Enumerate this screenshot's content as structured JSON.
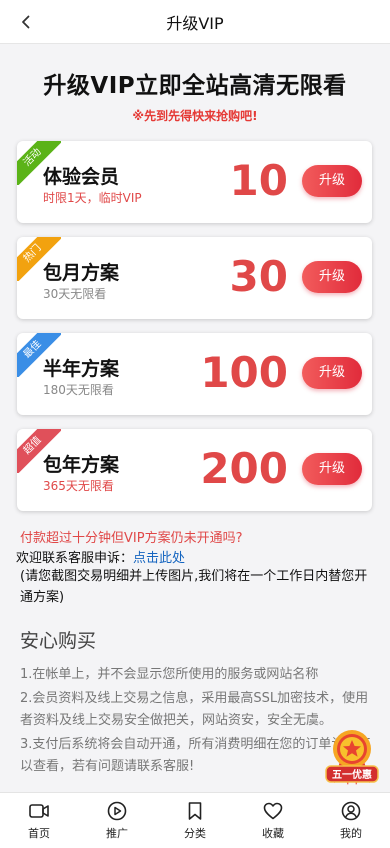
{
  "header": {
    "title": "升级VIP"
  },
  "hero": {
    "headline": "升级VIP立即全站高清无限看",
    "subline": "※先到先得快来抢购吧!"
  },
  "plans": [
    {
      "tag": "活动",
      "tag_color": "#5bb318",
      "name": "体验会员",
      "desc": "时限1天，临时VIP",
      "desc_color": "#e04848",
      "price": "10",
      "button": "升级"
    },
    {
      "tag": "热门",
      "tag_color": "#f2a20f",
      "name": "包月方案",
      "desc": "30天无限看",
      "desc_color": "#888888",
      "price": "30",
      "button": "升级"
    },
    {
      "tag": "最佳",
      "tag_color": "#3a8ee6",
      "name": "半年方案",
      "desc": "180天无限看",
      "desc_color": "#888888",
      "price": "100",
      "button": "升级"
    },
    {
      "tag": "超值",
      "tag_color": "#e0505a",
      "name": "包年方案",
      "desc": "365天无限看",
      "desc_color": "#e04848",
      "price": "200",
      "button": "升级"
    }
  ],
  "notice": {
    "question": "付款超过十分钟但VIP方案仍未开通吗?",
    "contact_prefix": "欢迎联系客服申诉：",
    "contact_link": "点击此处",
    "paren": "(请您截图交易明细并上传图片,我们将在一个工作日内替您开通方案)"
  },
  "safe": {
    "title": "安心购买",
    "items": [
      "1.在帐单上，并不会显示您所使用的服务或网站名称",
      "2.会员资料及线上交易之信息，采用最高SSL加密技术，使用者资料及线上交易安全做把关，网站资安，安全无虞。",
      "3.支付后系统将会自动开通，所有消费明细在您的订单记录可以查看，若有问题请联系客服!"
    ]
  },
  "badge": {
    "label": "五一优惠"
  },
  "tabbar": [
    {
      "label": "首页",
      "icon": "video-icon"
    },
    {
      "label": "推广",
      "icon": "play-circle-icon"
    },
    {
      "label": "分类",
      "icon": "bookmark-icon"
    },
    {
      "label": "收藏",
      "icon": "heart-icon"
    },
    {
      "label": "我的",
      "icon": "user-icon"
    }
  ]
}
